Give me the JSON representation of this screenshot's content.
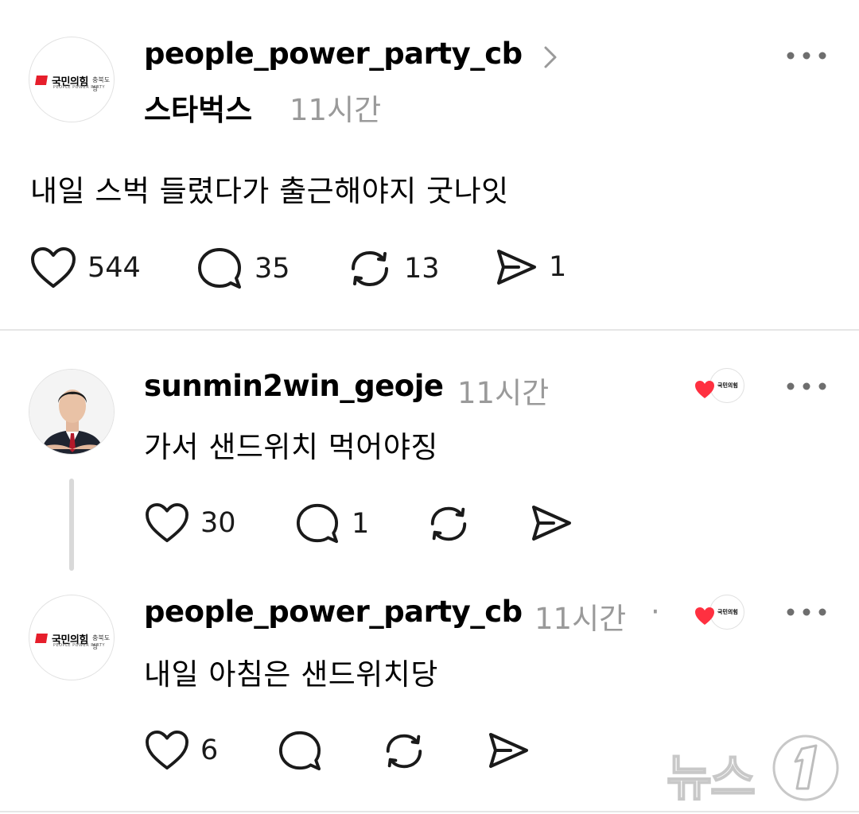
{
  "post": {
    "username": "people_power_party_cb",
    "tag": "스타벅스",
    "time": "11시간",
    "text": "내일 스벅 들렸다가 출근해야지 굿나잇",
    "likes": "544",
    "comments": "35",
    "reposts": "13",
    "shares": "1"
  },
  "replies": [
    {
      "username": "sunmin2win_geoje",
      "time": "11시간",
      "text": "가서 샌드위치 먹어야징",
      "likes": "30",
      "comments": "1"
    },
    {
      "username": "people_power_party_cb",
      "time": "11시간",
      "separator": "·",
      "text": "내일 아침은 샌드위치당",
      "likes": "6"
    }
  ],
  "logo": {
    "name": "국민의힘",
    "region": "충북도당",
    "sub": "PEOPLE POWER PARTY"
  },
  "watermark": {
    "text": "뉴스"
  },
  "colors": {
    "brand_red": "#e61e2b",
    "like_red": "#ff3040",
    "muted": "#9a9a9a"
  }
}
